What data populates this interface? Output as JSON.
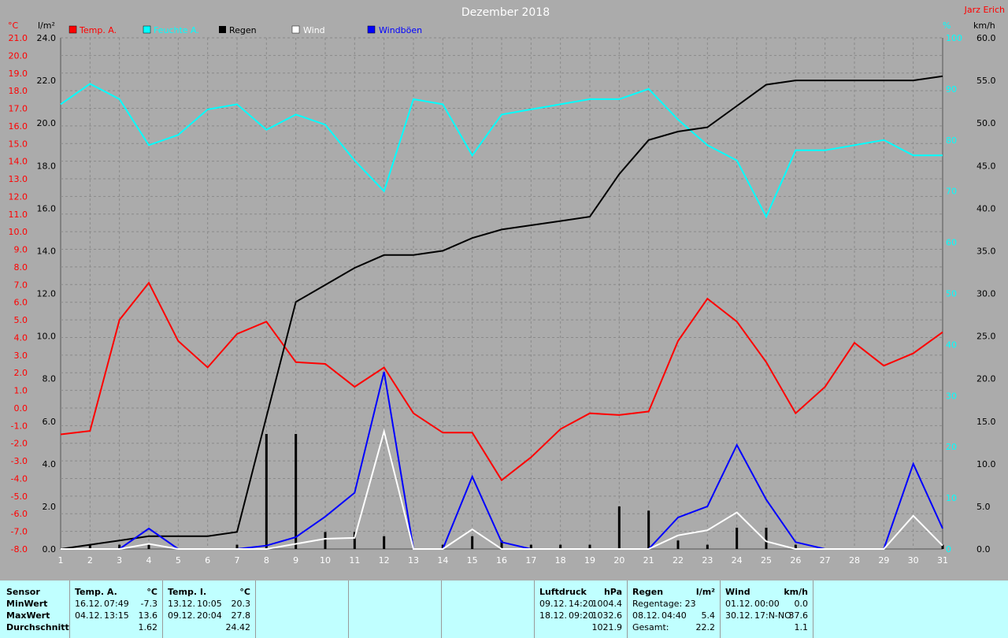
{
  "chart_data": {
    "type": "line",
    "title": "Dezember 2018",
    "author": "Jarz Erich",
    "colors": {
      "temp_a": "#ff0000",
      "feuchte_a": "#00ffff",
      "regen": "#000000",
      "wind": "#ffffff",
      "windboeen": "#0000ff",
      "background": "#ababab",
      "grid": "#888888"
    },
    "axes": {
      "temp": {
        "unit": "°C",
        "min": -8.0,
        "max": 21.0,
        "step": 1.0,
        "color": "#ff0000",
        "position": "left-outer"
      },
      "regen": {
        "unit": "l/m²",
        "min": 0.0,
        "max": 24.0,
        "step": 2.0,
        "color": "#000000",
        "position": "left-inner"
      },
      "feuchte": {
        "unit": "%",
        "min": 0,
        "max": 100,
        "step": 10,
        "color": "#00ffff",
        "position": "right-inner"
      },
      "wind": {
        "unit": "km/h",
        "min": 0.0,
        "max": 60.0,
        "step": 5.0,
        "color": "#000000",
        "position": "right-outer"
      }
    },
    "x": [
      1,
      2,
      3,
      4,
      5,
      6,
      7,
      8,
      9,
      10,
      11,
      12,
      13,
      14,
      15,
      16,
      17,
      18,
      19,
      20,
      21,
      22,
      23,
      24,
      25,
      26,
      27,
      28,
      29,
      30,
      31
    ],
    "grid": true,
    "legend_position": "top",
    "series": [
      {
        "name": "Temp. A.",
        "axis": "temp",
        "color": "#ff0000",
        "values": [
          -1.5,
          -1.3,
          5.0,
          7.1,
          3.8,
          2.3,
          4.2,
          4.9,
          2.6,
          2.5,
          1.2,
          2.3,
          -0.3,
          -1.4,
          -1.4,
          -4.1,
          -2.8,
          -1.2,
          -0.3,
          -0.4,
          -0.2,
          3.8,
          6.2,
          4.9,
          2.6,
          -0.3,
          1.2,
          3.7,
          2.4,
          3.1,
          4.3
        ]
      },
      {
        "name": "Feuchte A.",
        "axis": "feuchte",
        "color": "#00ffff",
        "values": [
          87,
          91,
          88,
          79,
          81,
          86,
          87,
          82,
          85,
          83,
          76,
          70,
          88,
          87,
          77,
          85,
          86,
          87,
          88,
          88,
          90,
          84,
          79,
          76,
          65,
          78,
          78,
          79,
          80,
          77,
          77
        ]
      },
      {
        "name": "Regen",
        "axis": "regen",
        "color": "#000000",
        "values": [
          0.0,
          0.2,
          0.4,
          0.6,
          0.6,
          0.6,
          0.8,
          6.2,
          11.6,
          12.4,
          13.2,
          13.8,
          13.8,
          14.0,
          14.6,
          15.0,
          15.2,
          15.4,
          15.6,
          17.6,
          19.2,
          19.6,
          19.8,
          20.8,
          21.8,
          22.0,
          22.0,
          22.0,
          22.0,
          22.0,
          22.2
        ]
      },
      {
        "name": "Wind",
        "axis": "wind",
        "color": "#ffffff",
        "values": [
          0,
          0,
          0,
          0.6,
          0,
          0,
          0,
          0,
          0.6,
          1.2,
          1.3,
          13.8,
          0,
          0,
          2.3,
          0,
          0,
          0,
          0,
          0,
          0,
          1.6,
          2.2,
          4.3,
          0.9,
          0,
          0,
          0,
          0,
          3.9,
          0.4
        ]
      },
      {
        "name": "Windböen",
        "axis": "wind",
        "color": "#0000ff",
        "values": [
          0,
          0,
          0,
          2.4,
          0,
          0,
          0,
          0.4,
          1.4,
          3.8,
          6.6,
          20.8,
          0,
          0,
          8.5,
          0.8,
          0,
          0,
          0,
          0,
          0,
          3.7,
          5.0,
          12.2,
          5.8,
          0.8,
          0,
          0,
          0,
          10.0,
          2.4
        ]
      }
    ],
    "daily_rain": [
      0.0,
      0.2,
      0.2,
      0.2,
      0.0,
      0.0,
      0.2,
      5.4,
      5.4,
      0.8,
      0.8,
      0.6,
      0.0,
      0.2,
      0.6,
      0.4,
      0.2,
      0.2,
      0.2,
      2.0,
      1.8,
      0.4,
      0.2,
      1.0,
      1.0,
      0.2,
      0.0,
      0.0,
      0.0,
      0.0,
      0.2
    ]
  },
  "legend": {
    "temp_a": "Temp. A.",
    "feuchte_a": "Feuchte A.",
    "regen": "Regen",
    "wind": "Wind",
    "windboeen": "Windböen"
  },
  "stats": {
    "labels": {
      "sensor": "Sensor",
      "min": "MinWert",
      "max": "MaxWert",
      "avg": "Durchschnitt"
    },
    "temp_a": {
      "title": "Temp. A.",
      "unit": "°C",
      "min_date": "16.12.",
      "min_time": "07:49",
      "min_val": "-7.3",
      "max_date": "04.12.",
      "max_time": "13:15",
      "max_val": "13.6",
      "avg": "1.62"
    },
    "temp_i": {
      "title": "Temp. I.",
      "unit": "°C",
      "min_date": "13.12.",
      "min_time": "10:05",
      "min_val": "20.3",
      "max_date": "09.12.",
      "max_time": "20:04",
      "max_val": "27.8",
      "avg": "24.42"
    },
    "luftdruck": {
      "title": "Luftdruck",
      "unit": "hPa",
      "min_date": "09.12.",
      "min_time": "14:20",
      "min_val": "1004.4",
      "max_date": "18.12.",
      "max_time": "09:20",
      "max_val": "1032.6",
      "avg": "1021.9"
    },
    "regen": {
      "title": "Regen",
      "unit": "l/m²",
      "row1": "Regentage: 23",
      "max_date": "08.12.",
      "max_time": "04:40",
      "max_val": "5.4",
      "total_label": "Gesamt:",
      "total": "22.2"
    },
    "wind": {
      "title": "Wind",
      "unit": "km/h",
      "min_date": "01.12.",
      "min_time": "00:00",
      "min_val": "0.0",
      "max_date": "30.12.",
      "max_time": "17:N-NO",
      "max_val": "37.6",
      "avg": "1.1"
    }
  }
}
